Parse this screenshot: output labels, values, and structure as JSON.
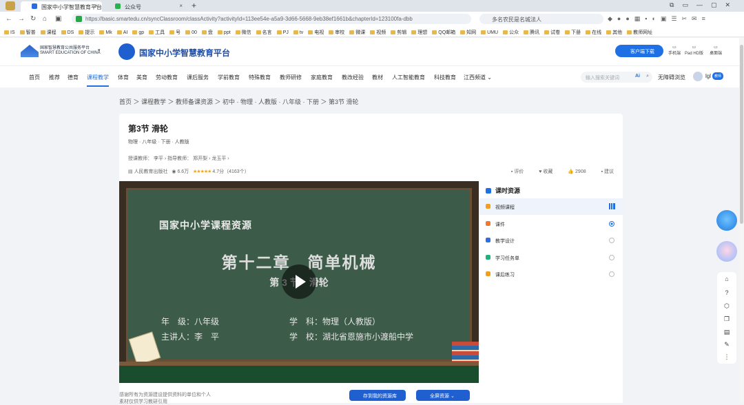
{
  "browser": {
    "tabs": [
      {
        "label": "国家中小学智慧教育平台"
      },
      {
        "label": "公众号"
      }
    ],
    "url": "https://basic.smartedu.cn/syncClassroom/classActivity?activityId=113ee54e-a5a9-3d66-5668-9eb38ef1661b&chapterId=123100fa-dbb",
    "search": "多名农民是名城法人",
    "bookmarks": [
      "IS",
      "智普",
      "课程",
      "DS",
      "提示",
      "Mk",
      "AI",
      "gp",
      "工具",
      "号",
      "00",
      "盘",
      "ppt",
      "微信",
      "名言",
      "PJ",
      "tv",
      "电视",
      "审校",
      "微课",
      "视频",
      "剪辑",
      "理想",
      "QQ邮箱",
      "知网",
      "UMU",
      "公众",
      "腾讯",
      "试卷",
      "下册",
      "在线",
      "其他",
      "教师网址"
    ]
  },
  "site": {
    "logo1_line1": "国家智慧教育公共服务平台",
    "logo1_line2": "SMART EDUCATION OF CHINA",
    "title": "国家中小学智慧教育平台",
    "download": "客户端下载",
    "devices": [
      "手机端",
      "Pad HD版",
      "桌面端"
    ]
  },
  "nav": {
    "items": [
      "首页",
      "推荐",
      "德育",
      "课程教学",
      "体育",
      "美育",
      "劳动教育",
      "课后服务",
      "学前教育",
      "特殊教育",
      "教师研修",
      "家庭教育",
      "教改经验",
      "教材",
      "人工智能教育",
      "科技教育",
      "江西频道 ⌄"
    ],
    "active": "课程教学",
    "search_placeholder": "输入搜索关键词",
    "barrier_free": "无障碍浏览",
    "user": "lgl"
  },
  "breadcrumb": "首页 ＞ 课程教学 ＞ 教师备课资源 ＞ 初中 · 物理 · 人教版 · 八年级 · 下册 ＞ 第3节 滑轮",
  "lesson": {
    "title": "第3节 滑轮",
    "meta": "物理 · 八年级 · 下册 · 人教版",
    "teachers": "授课教师：  李平 ›      指导教师：  郑开梨 ›   龙玉平 ›",
    "publisher": "人民教育出版社",
    "views": "6.6万",
    "stars": "★★★★★",
    "rating": "4.7分（4163个）",
    "actions": [
      "评价",
      "收藏",
      "2908",
      "建议"
    ]
  },
  "slide": {
    "org": "国家中小学课程资源",
    "chapter": "第十二章　简单机械",
    "section": "第 3 节　滑轮",
    "left_lines": [
      "年　级：八年级",
      "主讲人：李　平"
    ],
    "right_lines": [
      "学　科：物理（人教版）",
      "学　校：湖北省恩施市小渡船中学"
    ]
  },
  "side": {
    "heading": "课时资源",
    "items": [
      {
        "label": "视频课程",
        "color": "#f0a020"
      },
      {
        "label": "课件",
        "color": "#f07a2a"
      },
      {
        "label": "教学设计",
        "color": "#2b6fe0"
      },
      {
        "label": "学习任务单",
        "color": "#22b07d"
      },
      {
        "label": "课后练习",
        "color": "#f0a020"
      }
    ]
  },
  "footer": {
    "note1": "感谢所有为资源建设提供资料的单位和个人",
    "note2": "素材仅供学习教研引用",
    "save": "存到我的资源库",
    "fullscreen": "全屏资源 ⌄"
  }
}
